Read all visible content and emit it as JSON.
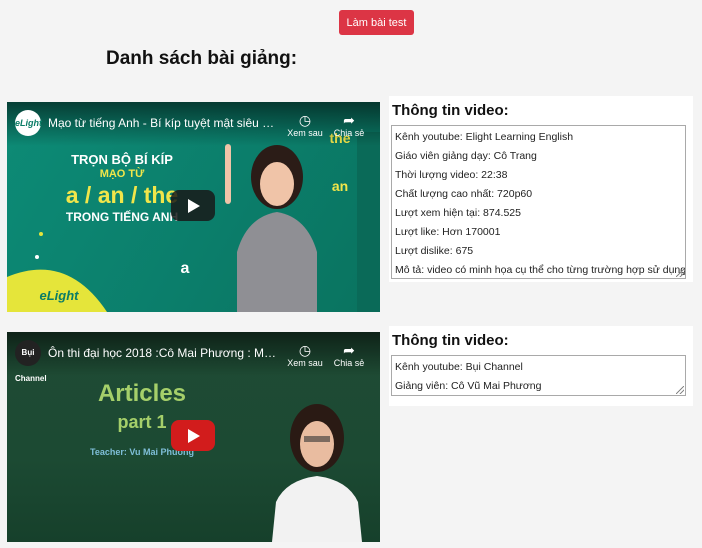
{
  "top": {
    "test_button": "Làm bài test",
    "heading": "Danh sách bài giảng:"
  },
  "videos": [
    {
      "title": "Mạo từ tiếng Anh - Bí kíp tuyệt mật siêu d...",
      "channel_logo": "eLight",
      "watch_later": "Xem sau",
      "share": "Chia sẻ",
      "thumb": {
        "line1": "TRỌN BỘ BÍ KÍP",
        "line2": "MẠO TỪ",
        "line3": "a / an / the",
        "line4": "TRONG TIẾNG ANH",
        "brand": "eLight",
        "side1": "the",
        "side2": "an",
        "side3": "a"
      },
      "info_title": "Thông tin video:",
      "info": [
        "Kênh youtube: Elight Learning English",
        "Giáo viên giảng dạy: Cô Trang",
        "Thời lượng video: 22:38",
        "Chất lượng cao nhất: 720p60",
        "Lượt xem hiện tại: 874.525",
        "Lượt like: Hơn 170001",
        "Lượt dislike: 675",
        "Mô tả: video có minh họa cụ thể cho từng trường hợp sử dụng."
      ]
    },
    {
      "title": "Ôn thi đại học 2018 :Cô Mai Phương : Mạ...",
      "channel_logo": "Bụi Channel",
      "watch_later": "Xem sau",
      "share": "Chia sẻ",
      "thumb": {
        "line1": "Articles",
        "line2": "part 1",
        "line3": "Teacher: Vu Mai Phuong"
      },
      "info_title": "Thông tin video:",
      "info": [
        "Kênh youtube: Bụi Channel",
        "Giảng viên: Cô Vũ Mai Phương"
      ]
    }
  ],
  "colors": {
    "button": "#dc3545",
    "thumb1": "#0b7e6b",
    "thumb2": "#1c4a33"
  }
}
